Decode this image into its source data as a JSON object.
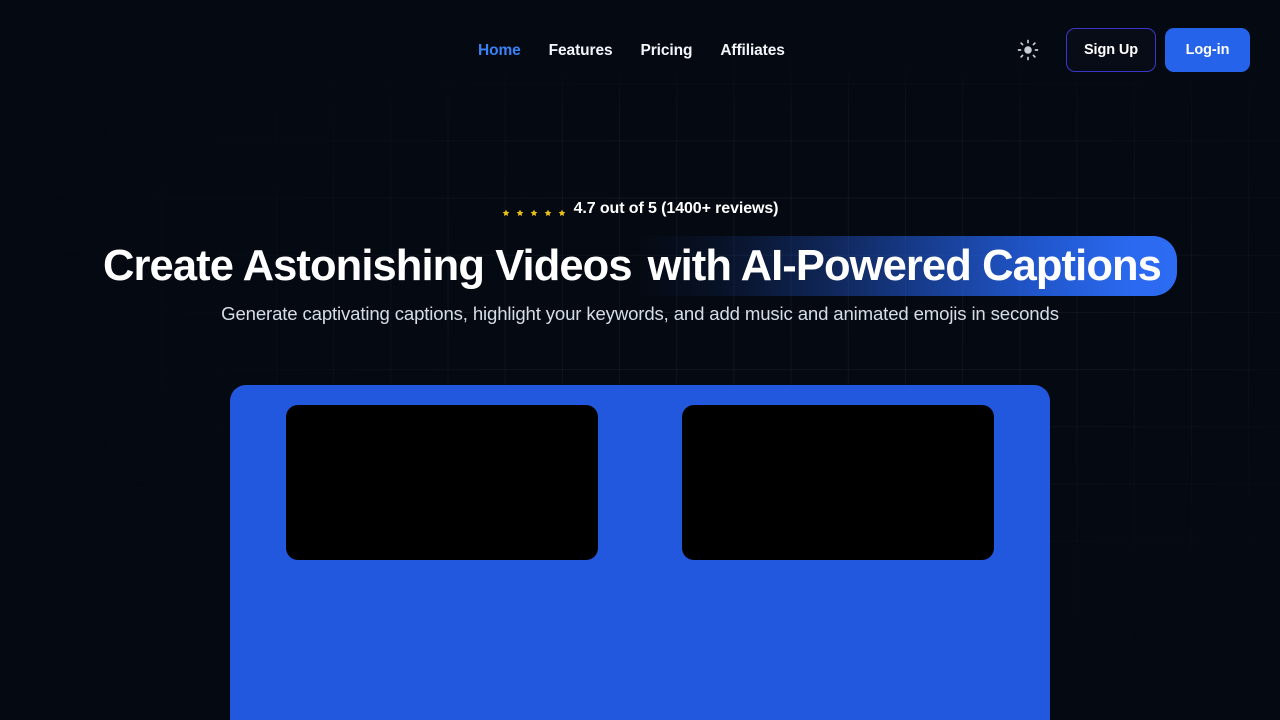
{
  "theme": {
    "background": "#050911",
    "accent_blue": "#2563eb",
    "card_blue": "#2258de",
    "nav_active": "#3b82f6",
    "star_color": "#e8c117",
    "signup_border": "#3b37c9"
  },
  "header": {
    "nav": [
      {
        "label": "Home",
        "active": true
      },
      {
        "label": "Features",
        "active": false
      },
      {
        "label": "Pricing",
        "active": false
      },
      {
        "label": "Affiliates",
        "active": false
      }
    ],
    "theme_toggle_icon": "sun-icon",
    "signup_label": "Sign Up",
    "login_label": "Log-in"
  },
  "hero": {
    "rating": {
      "star_count": 5,
      "star_icon": "star-icon",
      "text": "4.7 out of 5 (1400+ reviews)",
      "score": "4.7",
      "out_of": "5",
      "review_count": "1400+"
    },
    "headline": {
      "plain": "Create Astonishing Videos",
      "highlight": "with AI-Powered Captions"
    },
    "subtitle": "Generate captivating captions, highlight your keywords, and add music and animated emojis in seconds"
  },
  "showcase": {
    "videos": [
      {
        "label": "video-preview-1"
      },
      {
        "label": "video-preview-2"
      }
    ]
  }
}
